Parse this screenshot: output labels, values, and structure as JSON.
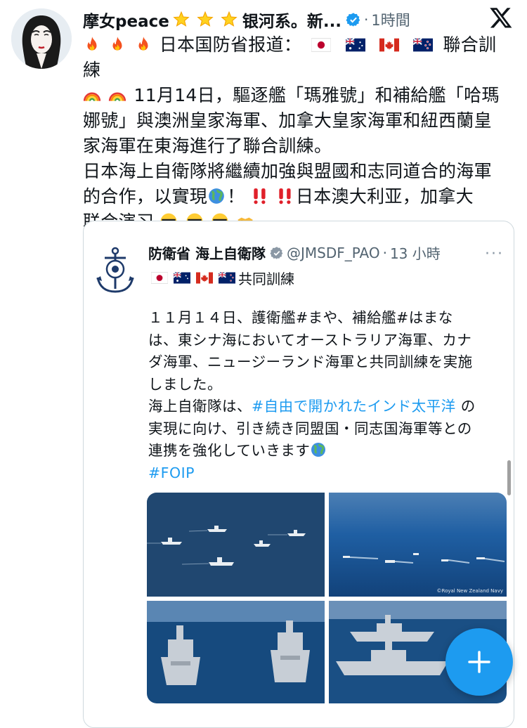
{
  "tweet": {
    "author": "摩女peace",
    "author_suffix": "银河系。新...",
    "separator": "·",
    "time": "1時間",
    "line1": "日本国防省报道：",
    "line1_end": "聯合訓練",
    "line2": "11月14日，驅逐艦「瑪雅號」和補給艦「哈瑪",
    "line3": "娜號」與澳洲皇家海軍、加拿大皇家海軍和紐西蘭皇",
    "line4": "家海軍在東海進行了聯合訓練。",
    "line5": "日本海上自衛隊將繼續加強與盟國和志同道合的海軍",
    "line6a": "的合作，以實現",
    "line6b": "！",
    "line6c": "日本澳大利亚，加拿大",
    "line7": "联合演习"
  },
  "quote": {
    "name": "防衛省 海上自衛隊",
    "handle": "@JMSDF_PAO",
    "separator": "·",
    "time": "13 小時",
    "more": "···",
    "sub": "共同訓練",
    "p1_l1": "１１月１４日、護衛艦#まや、補給艦#はまな",
    "p1_l2": "は、東シナ海においてオーストラリア海軍、カナ",
    "p1_l3": "ダ海軍、ニュージーランド海軍と共同訓練を実施",
    "p1_l4": "しました。",
    "p2_l1a": "海上自衛隊は、",
    "p2_l1b": "#自由で開かれたインド太平洋",
    "p2_l1c": " の",
    "p2_l2": "実現に向け、引き続き同盟国・同志国海軍等との",
    "p2_l3": "連携を強化していきます",
    "hashtag": "#FOIP",
    "photo_credit": "©Royal New Zealand Navy"
  },
  "colors": {
    "link": "#1d9bf0",
    "text": "#0f1419",
    "muted": "#536471",
    "fab": "#1d9bf0"
  },
  "icons": [
    "verified-badge-icon",
    "x-logo-icon",
    "fire-emoji-icon",
    "rainbow-emoji-icon",
    "globe-emoji-icon",
    "double-exclamation-icon",
    "sunglasses-emoji-icon",
    "handshake-emoji-icon",
    "jmsdf-logo-icon",
    "more-icon",
    "plus-icon"
  ]
}
